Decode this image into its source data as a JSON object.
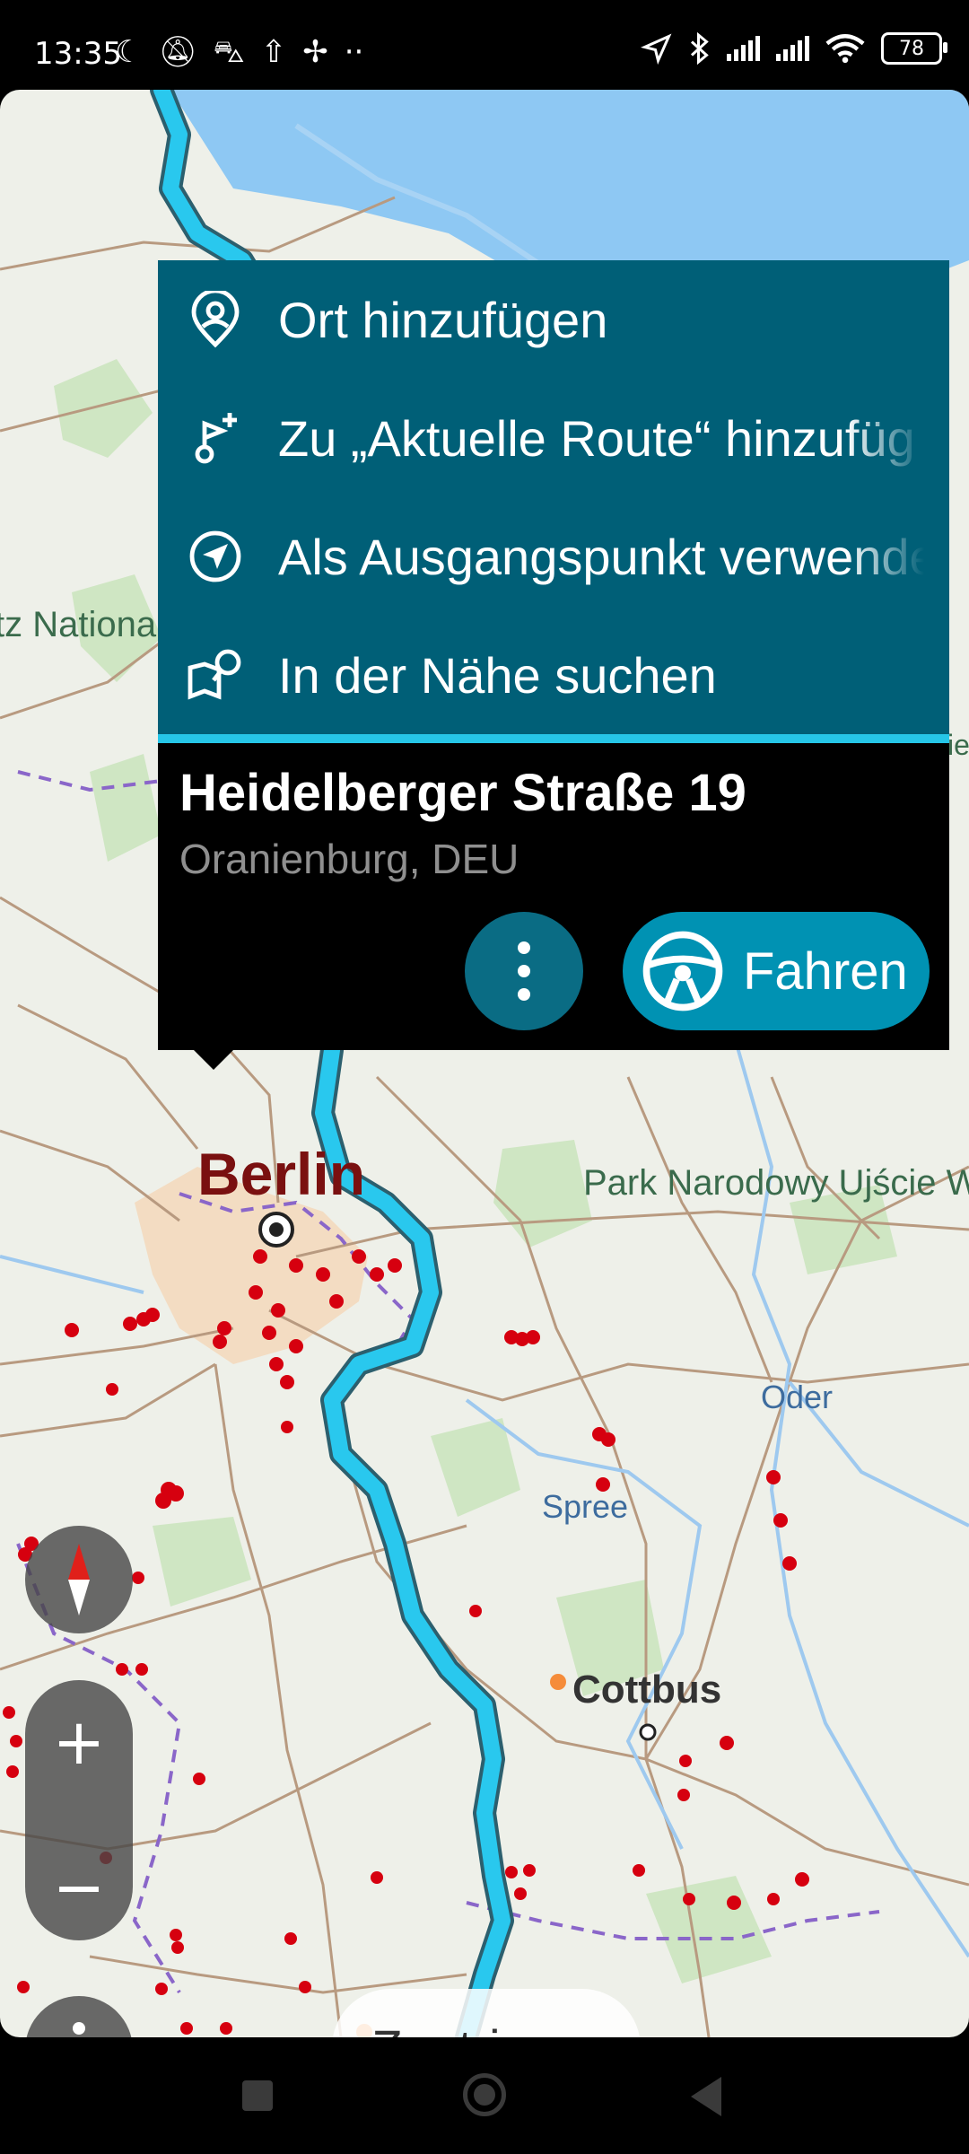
{
  "status_bar": {
    "time": "13:35",
    "battery": "78",
    "left_icons": [
      "moon-icon",
      "bell-off-icon",
      "car-icon",
      "upload-icon",
      "fan-icon",
      "more-dots-icon"
    ],
    "right_icons": [
      "location-arrow-icon",
      "bluetooth-icon",
      "signal-icon",
      "signal-icon",
      "wifi-icon",
      "battery-icon"
    ]
  },
  "map": {
    "labels": {
      "berlin": "Berlin",
      "cottbus": "Cottbus",
      "park": "Park Narodowy Ujście W",
      "national": "tz Nationa",
      "oder": "Oder",
      "spree": "Spree",
      "edge": "ie"
    },
    "route_color": "#29c8ee"
  },
  "popup": {
    "menu": [
      {
        "label": "Ort hinzufügen",
        "icon": "location-pin-icon"
      },
      {
        "label": "Zu „Aktuelle Route“ hinzufüg",
        "icon": "add-route-icon"
      },
      {
        "label": "Als Ausgangspunkt verwende",
        "icon": "departure-arrow-icon"
      },
      {
        "label": "In der Nähe suchen",
        "icon": "search-nearby-icon"
      }
    ],
    "address_title": "Heidelberger Straße 19",
    "address_subtitle": "Oranienburg, DEU",
    "drive_label": "Fahren"
  },
  "controls": {
    "zoom_in": "+",
    "zoom_out": "−",
    "center_label": "Zentrieren"
  },
  "colors": {
    "menu_bg": "#005f77",
    "accent": "#26c6e8",
    "drive_button": "#0092b3"
  }
}
